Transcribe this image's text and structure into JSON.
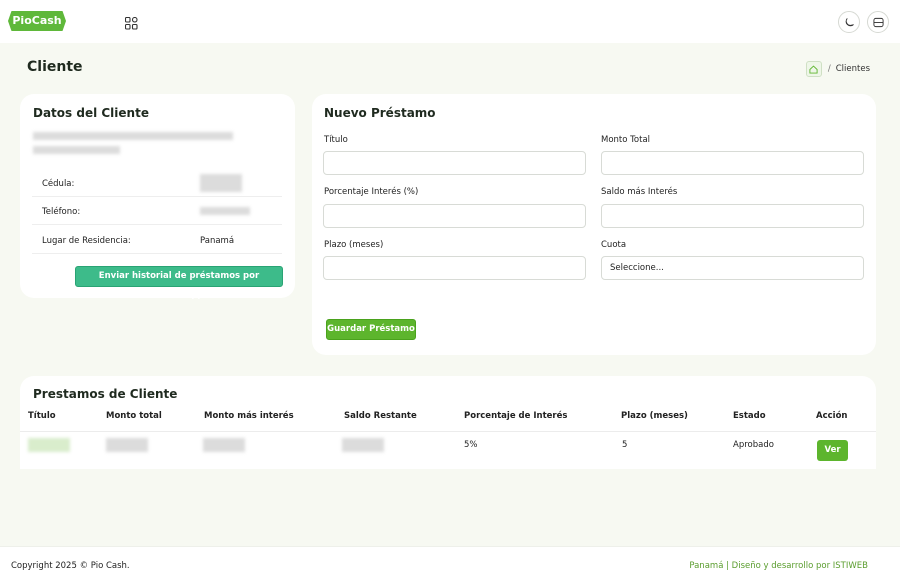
{
  "app": {
    "logo": "PioCash"
  },
  "header": {
    "title": "Cliente",
    "breadcrumb": {
      "current": "Clientes",
      "separator": "/"
    }
  },
  "client": {
    "title": "Datos del Cliente",
    "fields": [
      {
        "label": "Cédula:",
        "value": ""
      },
      {
        "label": "Teléfono:",
        "value": ""
      },
      {
        "label": "Lugar de Residencia:",
        "value": "Panamá"
      }
    ],
    "whatsapp_button": "Enviar historial de préstamos por WhatsApp"
  },
  "loan_form": {
    "title": "Nuevo Préstamo",
    "titulo_label": "Título",
    "monto_label": "Monto Total",
    "interes_label": "Porcentaje Interés (%)",
    "saldo_label": "Saldo más Interés",
    "plazo_label": "Plazo (meses)",
    "cuota_label": "Cuota",
    "cuota_value": "Seleccione...",
    "save_button": "Guardar Préstamo"
  },
  "loans_table": {
    "title": "Prestamos de Cliente",
    "columns": [
      "Título",
      "Monto total",
      "Monto más interés",
      "Saldo Restante",
      "Porcentaje de Interés",
      "Plazo (meses)",
      "Estado",
      "Acción"
    ],
    "rows": [
      {
        "titulo": "",
        "monto_total": "",
        "monto_interes": "",
        "saldo": "",
        "porcentaje": "5%",
        "plazo": "5",
        "estado": "Aprobado",
        "accion": "Ver"
      }
    ]
  },
  "footer": {
    "copyright": "Copyright 2025 © Pio Cash.",
    "credits": "Panamá | Diseño y desarrollo por ISTIWEB"
  },
  "colors": {
    "brand": "#5db52d",
    "whatsapp": "#3dbb8a"
  }
}
